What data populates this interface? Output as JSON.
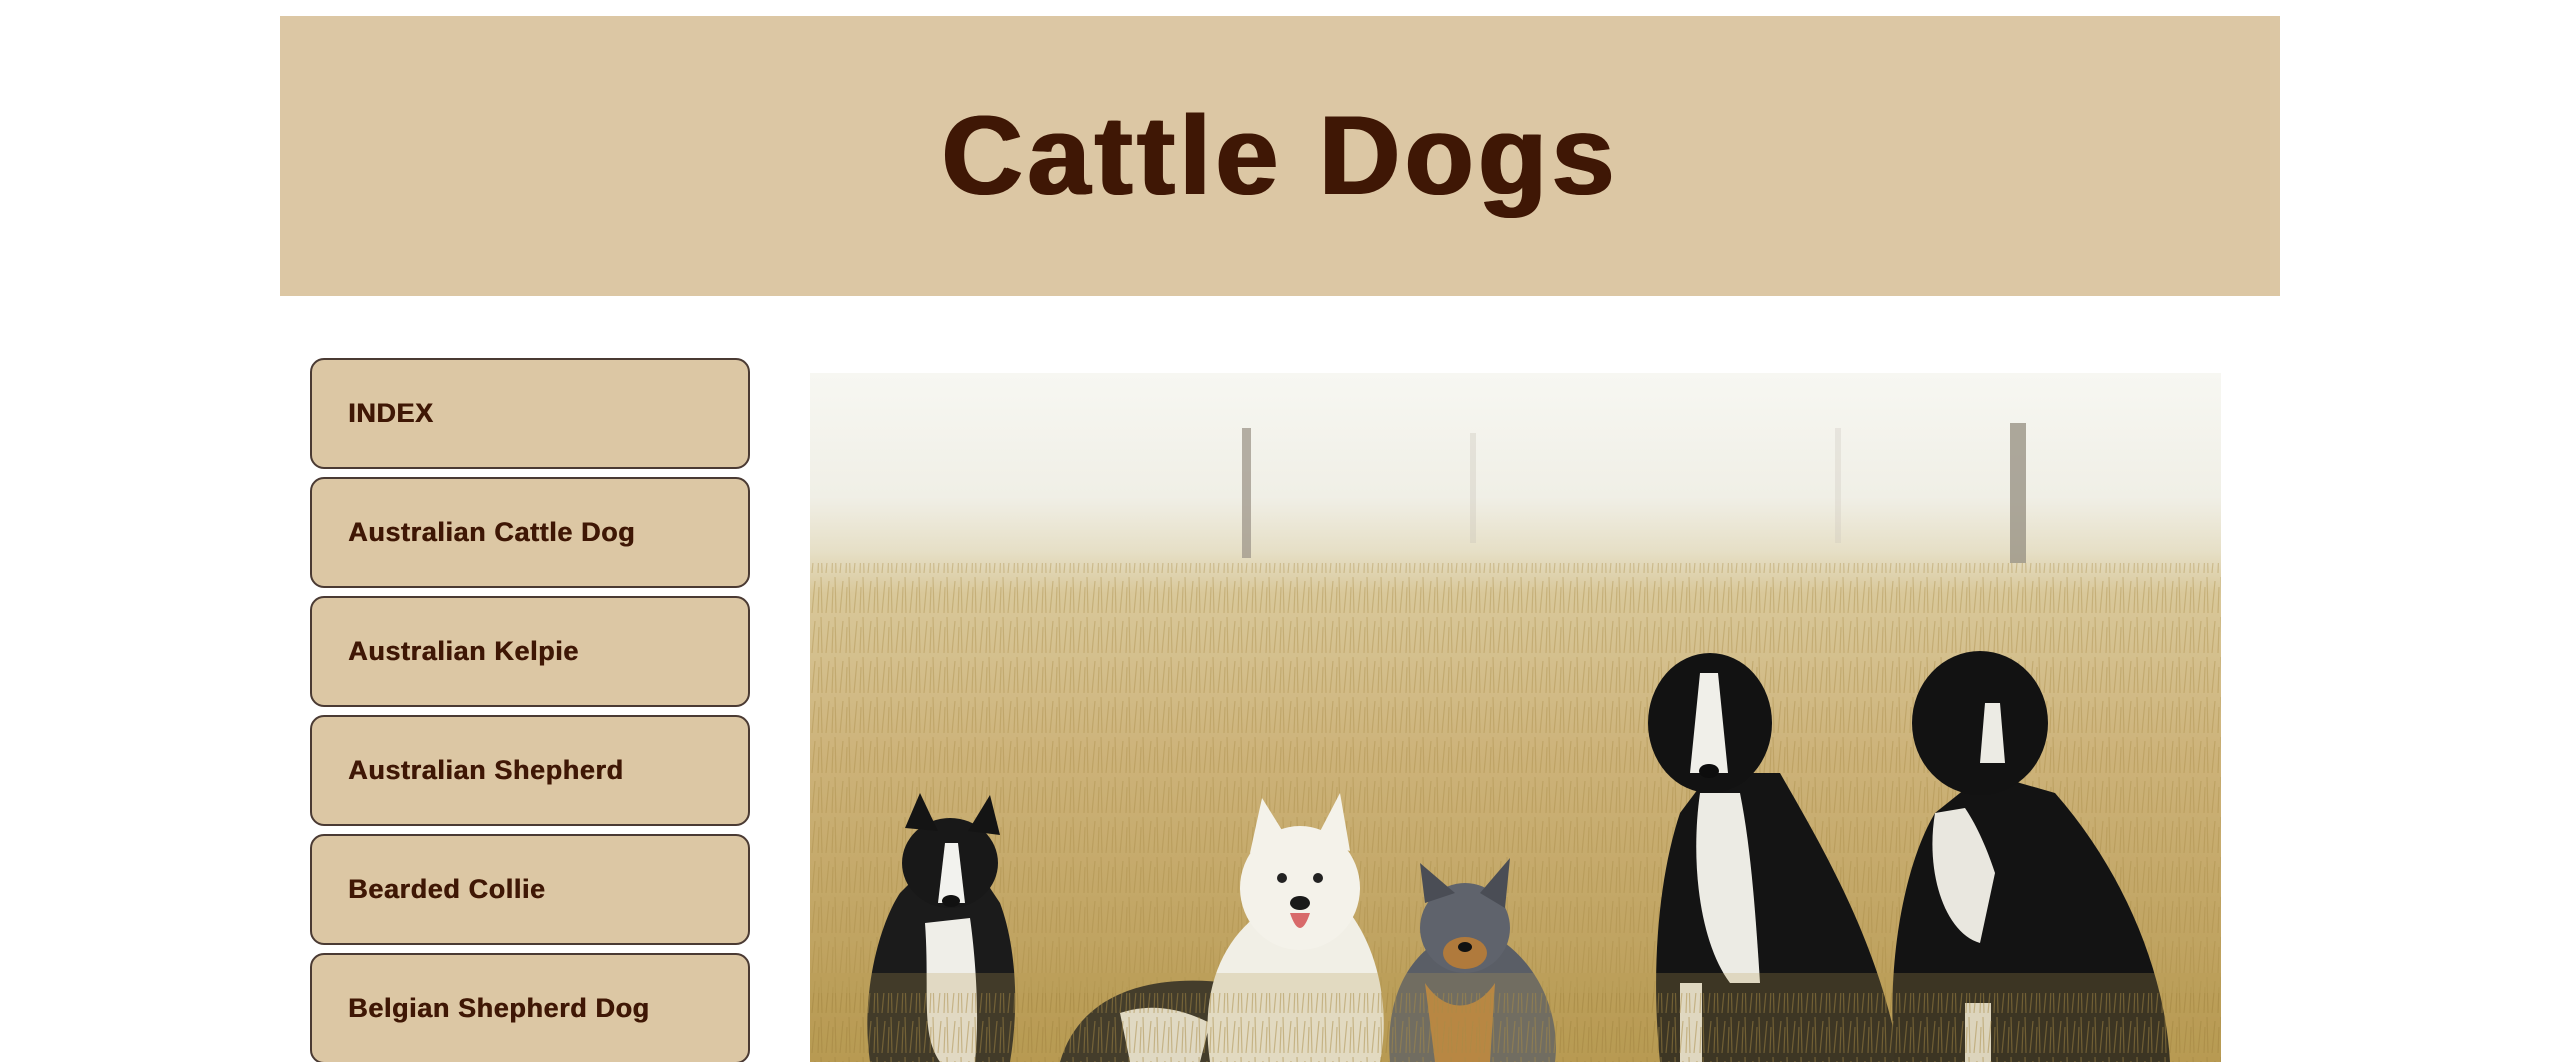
{
  "header": {
    "title": "Cattle Dogs"
  },
  "sidebar": {
    "items": [
      {
        "label": "INDEX"
      },
      {
        "label": "Australian Cattle Dog"
      },
      {
        "label": "Australian Kelpie"
      },
      {
        "label": "Australian Shepherd"
      },
      {
        "label": "Bearded Collie"
      },
      {
        "label": "Belgian Shepherd Dog"
      }
    ]
  },
  "colors": {
    "banner_background": "#dcc7a4",
    "title_text": "#3f1705",
    "nav_border": "#4a3a33"
  },
  "main_image": {
    "subject": "dogs-in-grass-field-photo"
  }
}
